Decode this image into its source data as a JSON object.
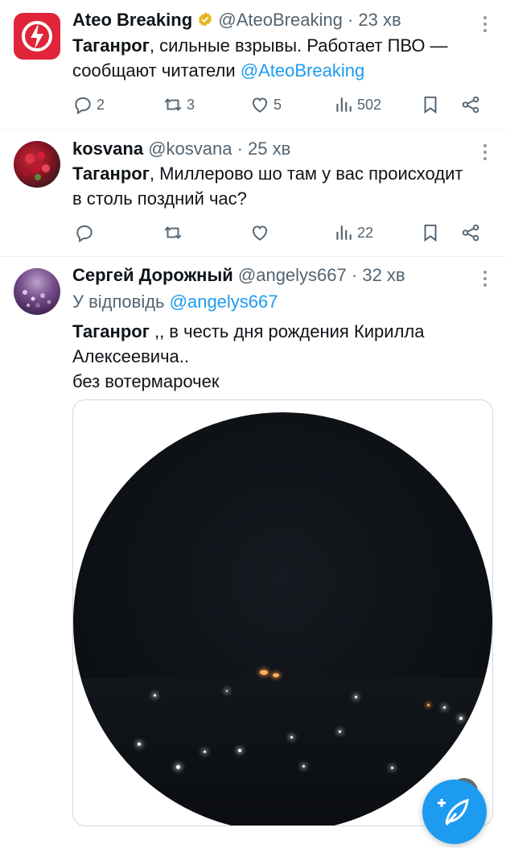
{
  "tweets": [
    {
      "name": "Ateo Breaking",
      "handle": "@AteoBreaking",
      "time": "23 хв",
      "text_bold": "Таганрог",
      "text_rest": ", сильные взрывы. Работает ПВО —",
      "text_line2": "сообщают читатели ",
      "mention": "@AteoBreaking",
      "replies": "2",
      "retweets": "3",
      "likes": "5",
      "views": "502"
    },
    {
      "name": "kosvana",
      "handle": "@kosvana",
      "time": "25 хв",
      "text_bold": "Таганрог",
      "text_rest": ", Миллерово шо там у вас происходит",
      "text_line2": "в столь поздний час?",
      "replies": "",
      "retweets": "",
      "likes": "",
      "views": "22"
    },
    {
      "name": "Сергей Дорожный",
      "handle": "@angelys667",
      "time": "32 хв",
      "reply_prefix": "У відповідь ",
      "reply_to": "@angelys667",
      "text_bold": "Таганрог",
      "text_rest": " ,, в честь дня рождения Кирилла",
      "text_line2": "Алексеевича..",
      "text_line3": "без вотермарочек"
    }
  ],
  "separator": "·",
  "icons": {
    "verified": "verified-badge-icon",
    "reply": "reply-icon",
    "retweet": "retweet-icon",
    "like": "heart-icon",
    "views": "views-icon",
    "bookmark": "bookmark-icon",
    "share": "share-icon",
    "compose": "compose-icon"
  },
  "colors": {
    "accent": "#1d9bf0",
    "secondary_text": "#536471",
    "brand_red": "#e0243a",
    "verified_gold": "#e2b719"
  }
}
